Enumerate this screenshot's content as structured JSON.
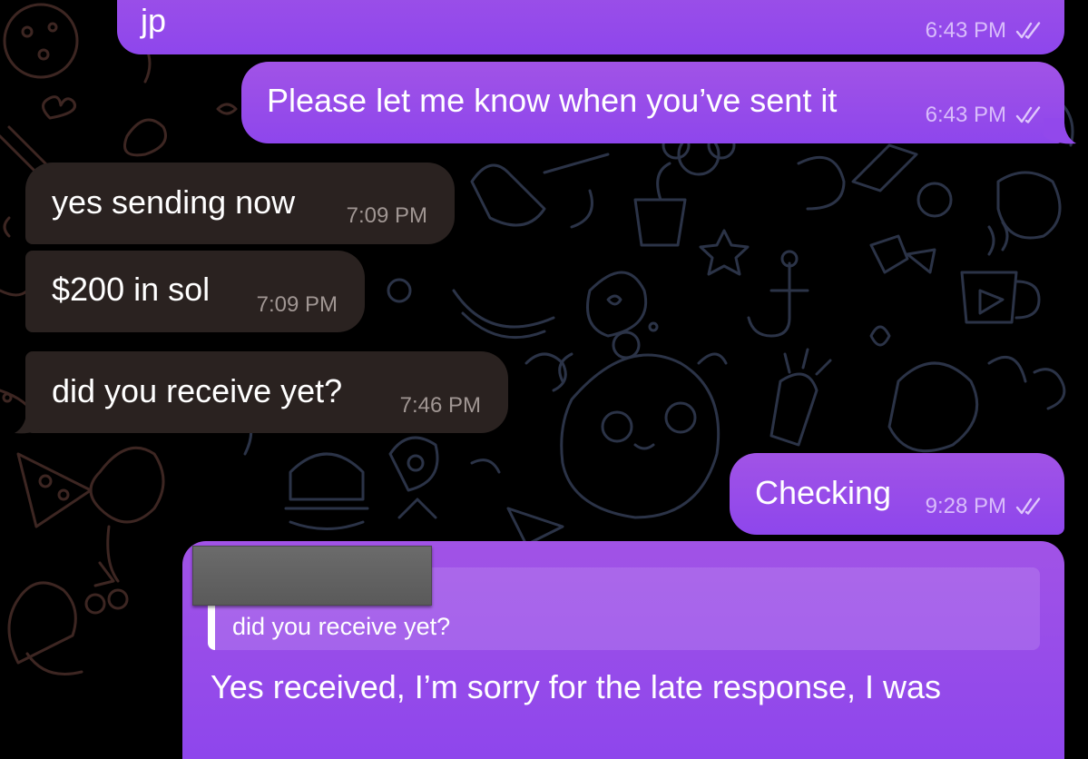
{
  "wallpaper": {
    "description": "doodle-pattern"
  },
  "colors": {
    "outgoing_bubble": "#9a4ee8",
    "incoming_bubble": "#2a2220",
    "background": "#000000",
    "text": "#ffffff"
  },
  "messages": [
    {
      "direction": "outgoing",
      "text": "jp",
      "time": "6:43 PM",
      "status_icon": "double-check-icon"
    },
    {
      "direction": "outgoing",
      "text": "Please let me know when you’ve sent it",
      "time": "6:43 PM",
      "status_icon": "double-check-icon"
    },
    {
      "direction": "incoming",
      "text": "yes sending now",
      "time": "7:09 PM"
    },
    {
      "direction": "incoming",
      "text": "$200 in sol",
      "time": "7:09 PM"
    },
    {
      "direction": "incoming",
      "text": "did you receive yet?",
      "time": "7:46 PM"
    },
    {
      "direction": "outgoing",
      "text": "Checking",
      "time": "9:28 PM",
      "status_icon": "double-check-icon"
    },
    {
      "direction": "outgoing",
      "reply_to": {
        "sender": "redacted",
        "text": "did you receive yet?"
      },
      "text": "Yes received, I’m sorry for the late response, I was"
    }
  ]
}
